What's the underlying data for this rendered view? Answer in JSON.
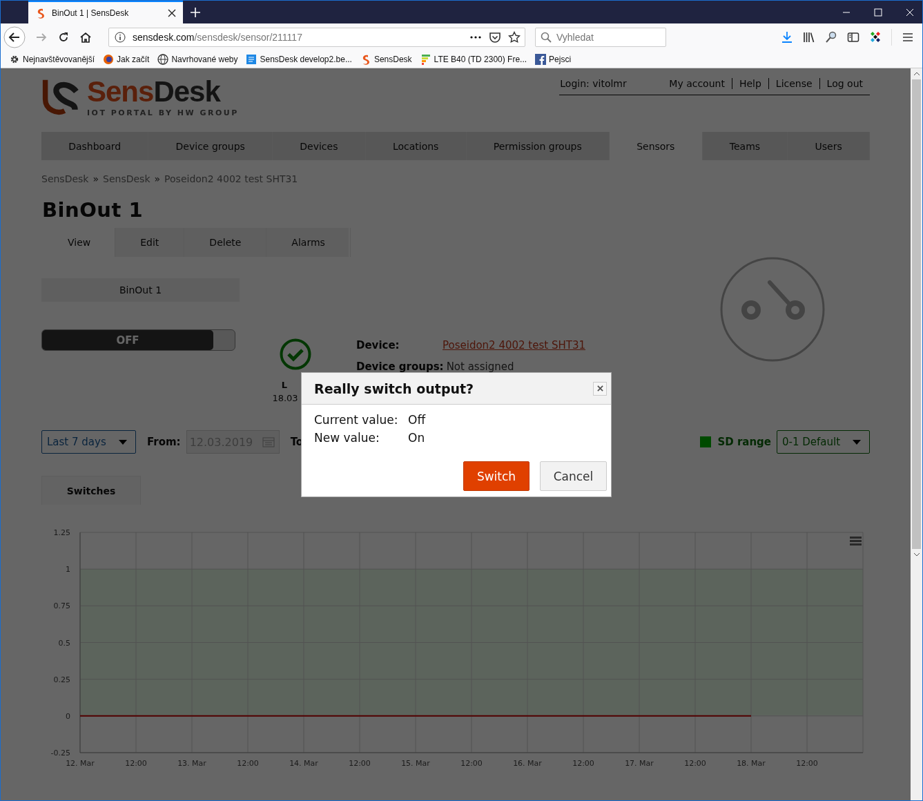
{
  "browser": {
    "tab_title": "BinOut 1 | SensDesk",
    "url_host": "sensdesk.com",
    "url_path": "/sensdesk/sensor/211117",
    "search_placeholder": "Vyhledat",
    "bookmarks": [
      {
        "kind": "gear",
        "label": "Nejnavštěvovanější"
      },
      {
        "kind": "fox",
        "label": "Jak začít"
      },
      {
        "kind": "globe",
        "label": "Navrhované weby"
      },
      {
        "kind": "doc",
        "label": "SensDesk develop2.be..."
      },
      {
        "kind": "logo",
        "label": "SensDesk"
      },
      {
        "kind": "signal",
        "label": "LTE B40 (TD 2300) Fre..."
      },
      {
        "kind": "facebook",
        "label": "Pejsci"
      }
    ]
  },
  "header": {
    "logo_first": "Sens",
    "logo_second": "Desk",
    "tagline": "IOT PORTAL BY HW GROUP",
    "login": "Login: vitolmr",
    "links": [
      "My account",
      "Help",
      "License",
      "Log out"
    ]
  },
  "nav": [
    {
      "label": "Dashboard",
      "selected": false
    },
    {
      "label": "Device groups",
      "selected": false
    },
    {
      "label": "Devices",
      "selected": false
    },
    {
      "label": "Locations",
      "selected": false
    },
    {
      "label": "Permission groups",
      "selected": false
    },
    {
      "label": "Sensors",
      "selected": true
    },
    {
      "label": "Teams",
      "selected": false
    },
    {
      "label": "Users",
      "selected": false
    }
  ],
  "breadcrumb": {
    "separator": "»",
    "items": [
      "SensDesk",
      "SensDesk",
      "Poseidon2 4002 test SHT31"
    ]
  },
  "title": "BinOut 1",
  "sensor_tabs": [
    {
      "label": "View",
      "selected": true
    },
    {
      "label": "Edit",
      "selected": false
    },
    {
      "label": "Delete",
      "selected": false
    },
    {
      "label": "Alarms",
      "selected": false
    }
  ],
  "sensor_name": "BinOut 1",
  "output_switch": {
    "label": "OFF",
    "on": false
  },
  "status": {
    "label": "L",
    "time": "18.03"
  },
  "details": [
    {
      "kind": "link",
      "label": "Device:",
      "value": "Poseidon2 4002 test SHT31"
    },
    {
      "kind": "text",
      "label": "Device groups:",
      "value": "Not assigned"
    }
  ],
  "filters": {
    "period": "Last 7 days",
    "from_label": "From:",
    "from_value": "12.03.2019",
    "to_label": "To",
    "sd_range": {
      "color": "#004a00",
      "label": "SD range",
      "value": "0-1 Default"
    }
  },
  "chart_tab": "Switches",
  "chart": {
    "chart_data": {
      "type": "line",
      "categories": [
        "12. Mar",
        "12:00",
        "13. Mar",
        "12:00",
        "14. Mar",
        "12:00",
        "15. Mar",
        "12:00",
        "16. Mar",
        "12:00",
        "17. Mar",
        "12:00",
        "18. Mar",
        "12:00",
        null
      ],
      "ylim": [
        -0.25,
        1.25
      ],
      "grid": true,
      "bands": [
        {
          "axis": "y",
          "from": 0,
          "to": 1,
          "color": "#5c645c"
        }
      ],
      "yticks": [
        {
          "value": -0.25,
          "label": "-0.25"
        },
        {
          "value": 0,
          "label": "0"
        },
        {
          "value": 0.25,
          "label": "0.25"
        },
        {
          "value": 0.5,
          "label": "0.5"
        },
        {
          "value": 0.75,
          "label": "0.75"
        },
        {
          "value": 1,
          "label": "1"
        },
        {
          "value": 1.25,
          "label": "1.25"
        }
      ],
      "series": [
        {
          "color": "#520000",
          "values": [
            0,
            0,
            0,
            0,
            0,
            0,
            0,
            0,
            0,
            0,
            0,
            0,
            0,
            null,
            null
          ]
        }
      ]
    }
  },
  "modal": {
    "title": "Really switch output?",
    "rows": [
      {
        "label": "Current value:",
        "value": "Off"
      },
      {
        "label": "New value:",
        "value": "On"
      }
    ],
    "buttons": [
      {
        "kind": "primary",
        "label": "Switch"
      },
      {
        "kind": "secondary",
        "label": "Cancel"
      }
    ]
  }
}
